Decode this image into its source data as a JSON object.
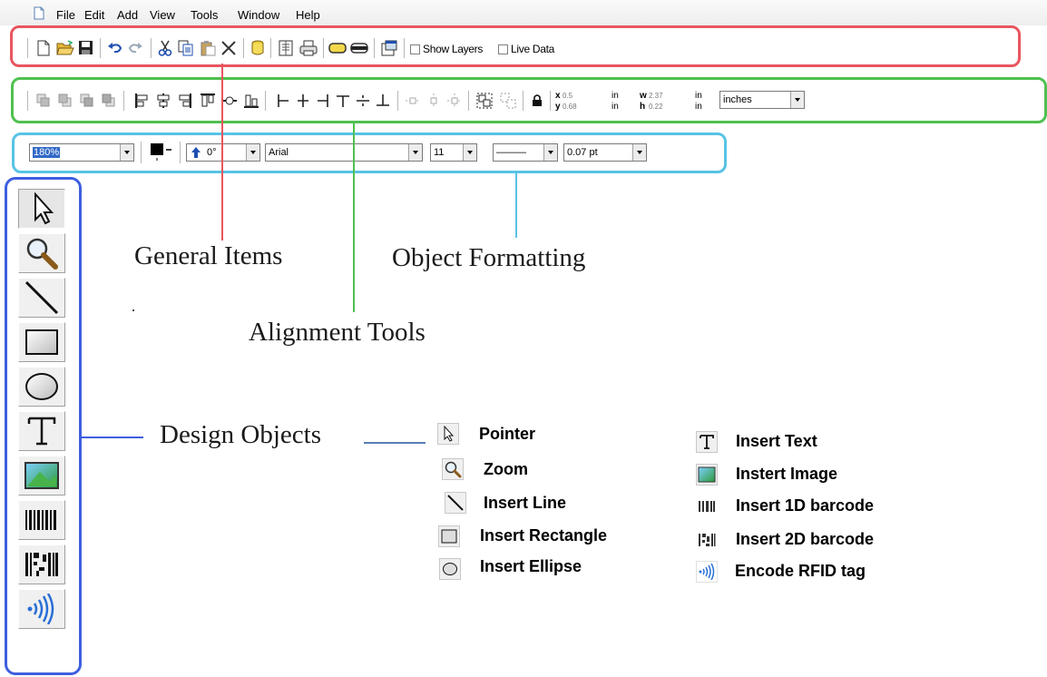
{
  "menubar": {
    "items": [
      "File",
      "Edit",
      "Add",
      "View",
      "Tools",
      "Window",
      "Help"
    ]
  },
  "general_toolbar": {
    "buttons": [
      "new-icon",
      "open-icon",
      "save-icon",
      "undo-icon",
      "redo-icon",
      "cut-icon",
      "copy-icon",
      "paste-icon",
      "delete-icon",
      "database-icon",
      "print-preview-icon",
      "print-icon",
      "rounded-rect-icon",
      "layers-icon",
      "properties-icon"
    ],
    "show_layers_label": "Show Layers",
    "live_data_label": "Live Data",
    "show_layers_checked": false,
    "live_data_checked": false
  },
  "alignment_toolbar": {
    "buttons": [
      "bring-forward-icon",
      "send-backward-icon",
      "bring-to-front-icon",
      "send-to-back-icon",
      "align-left-edges-icon",
      "align-centers-icon",
      "align-right-edges-icon",
      "align-top-edges-icon",
      "align-middle-icon",
      "align-bottom-edges-icon",
      "align-left-icon",
      "center-horizontal-icon",
      "align-right-icon",
      "align-top-icon",
      "center-vertical-icon",
      "align-bottom-icon",
      "distribute-horizontal-icon",
      "distribute-vertical-icon",
      "distribute-both-icon",
      "group-icon",
      "ungroup-icon",
      "lock-icon"
    ],
    "x_label": "x",
    "x_value": "0.5",
    "x_unit": "in",
    "y_label": "y",
    "y_value": "0.68",
    "y_unit": "in",
    "w_label": "w",
    "w_value": "2.37",
    "w_unit": "in",
    "h_label": "h",
    "h_value": "0.22",
    "h_unit": "in",
    "units_value": "inches"
  },
  "formatting_toolbar": {
    "zoom_value": "180%",
    "rotation_value": "0°",
    "font_value": "Arial",
    "font_size_value": "11",
    "line_style_value": "———",
    "line_width_value": "0.07 pt",
    "color": "#000000"
  },
  "design_toolbar": {
    "tools": [
      "pointer-icon",
      "zoom-icon",
      "line-icon",
      "rectangle-icon",
      "ellipse-icon",
      "text-icon",
      "image-icon",
      "barcode-1d-icon",
      "barcode-2d-icon",
      "rfid-icon"
    ]
  },
  "callouts": {
    "general_items": "General Items",
    "object_formatting": "Object Formatting",
    "alignment_tools": "Alignment Tools",
    "design_objects": "Design Objects"
  },
  "legend": {
    "left": [
      {
        "icon": "pointer-icon",
        "label": "Pointer"
      },
      {
        "icon": "zoom-icon",
        "label": "Zoom"
      },
      {
        "icon": "line-icon",
        "label": "Insert Line"
      },
      {
        "icon": "rectangle-icon",
        "label": "Insert Rectangle"
      },
      {
        "icon": "ellipse-icon",
        "label": "Insert Ellipse"
      }
    ],
    "right": [
      {
        "icon": "text-icon",
        "label": "Insert Text"
      },
      {
        "icon": "image-icon",
        "label": "Instert Image"
      },
      {
        "icon": "barcode-1d-icon",
        "label": "Insert 1D barcode"
      },
      {
        "icon": "barcode-2d-icon",
        "label": "Insert 2D barcode"
      },
      {
        "icon": "rfid-icon",
        "label": "Encode RFID tag"
      }
    ]
  },
  "colors": {
    "general_outline": "#e8565f",
    "alignment_outline": "#4fc04f",
    "formatting_outline": "#57c3e6",
    "design_outline": "#3e5fe0",
    "selection_blue": "#3169c6"
  }
}
